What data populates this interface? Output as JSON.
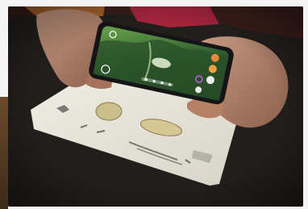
{
  "image": {
    "subject": "",
    "colors": {
      "table": "#1f1c1a",
      "paper": "#e7e4da",
      "skin": "#b98770",
      "phone_body": "#1b1b1d",
      "screen_green": "#3f7a3a",
      "shirt": "#b02840"
    },
    "icons": [
      "ar-camera-icon",
      "butterfly-marker-icon",
      "phone-control-icons"
    ]
  }
}
